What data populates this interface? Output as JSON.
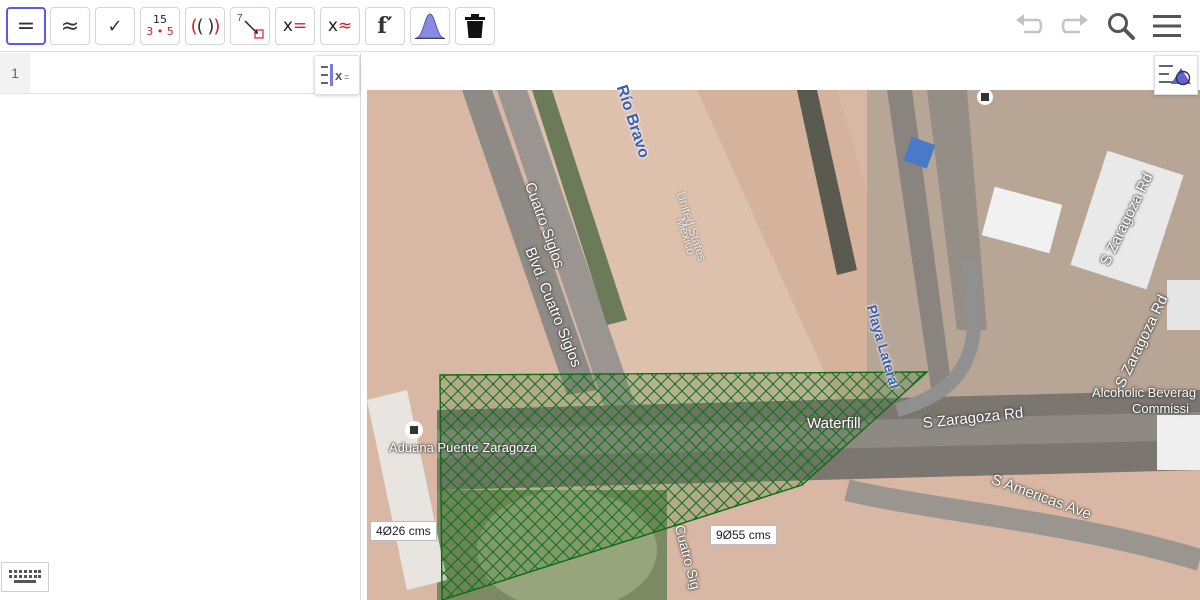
{
  "toolbar": {
    "buttons": {
      "evaluate": "=",
      "numeric": "≈",
      "keep_input": "✓",
      "factor_top": "15",
      "factor_bottom": "3 • 5",
      "expand_open": "(",
      "expand_mid": "( )",
      "expand_close": ")",
      "substitute_top": "7",
      "solve_x": "x",
      "solve_eq": "=",
      "nsolve_x": "x",
      "nsolve_eq": "≈",
      "derivative": "f′"
    }
  },
  "algebra": {
    "rows": [
      {
        "number": "1",
        "value": "",
        "placeholder": ""
      }
    ]
  },
  "graphics": {
    "labels": {
      "measure_left": "4Ø26 cms",
      "measure_right": "9Ø55 cms"
    },
    "map_labels": {
      "rio_bravo": "Río Bravo",
      "united_states": "United States",
      "mexico": "México",
      "cuatro_siglos": "Cuatro Siglos",
      "blvd_cuatro_siglos": "Blvd. Cuatro Siglos",
      "playa_lateral": "Playa Lateral",
      "s_zaragoza_rd_top": "S Zaragoza Rd",
      "s_zaragoza_rd_mid": "S Zaragoza Rd",
      "s_zaragoza_rd_bottom": "S Zaragoza Rd",
      "s_americas_ave": "S Americas Ave",
      "waterfill": "Waterfill",
      "alcoholic_bev": "Alcoholic Beverag",
      "commission": "Commissi",
      "aduana": "Aduana Puente Zaragoza",
      "cuatro_siglos_bottom": "Cuatro Sig"
    }
  },
  "colors": {
    "accent": "#5c5ce0",
    "red": "#d0202a",
    "polygon_stroke": "#0b6b0b",
    "polygon_fill": "#2e7d32"
  }
}
